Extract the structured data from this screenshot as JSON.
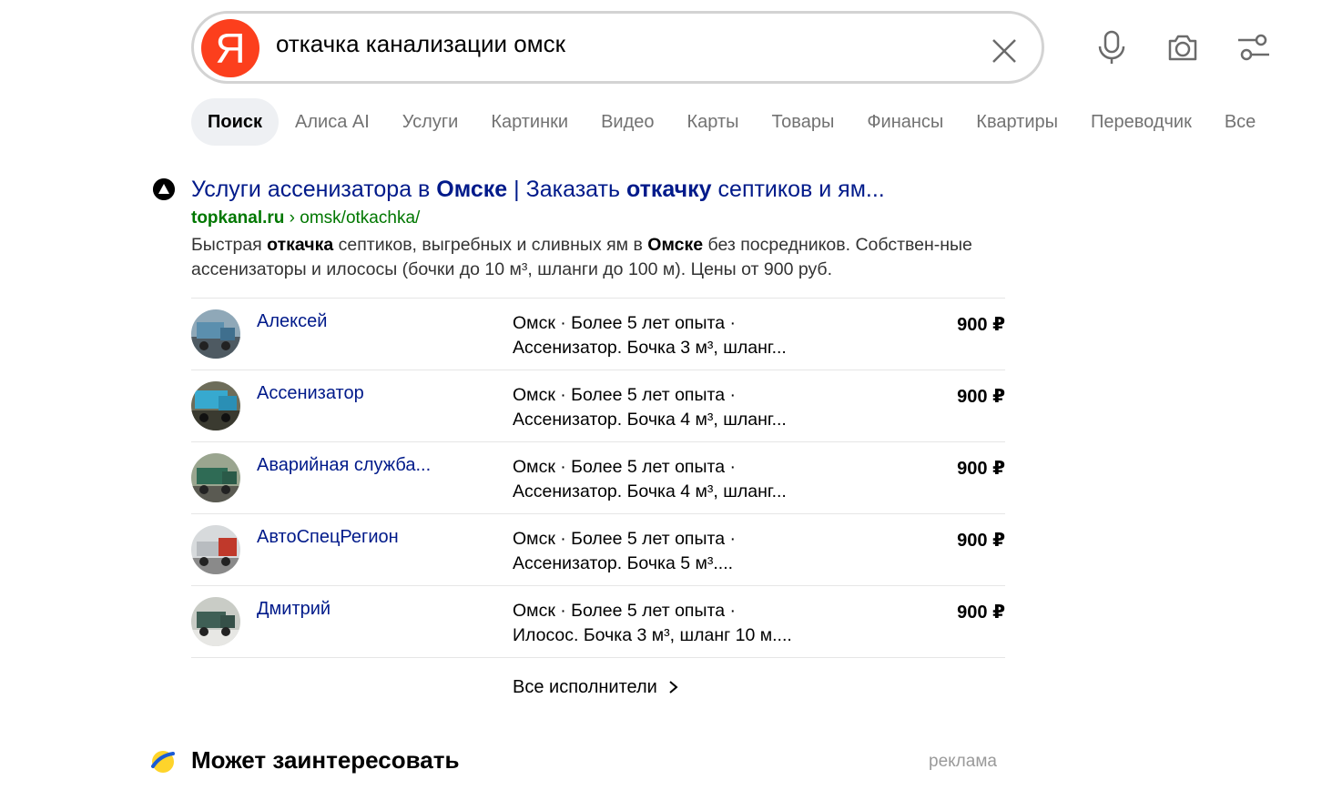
{
  "search": {
    "logo_letter": "Я",
    "query": "откачка канализации омск"
  },
  "tabs": [
    {
      "label": "Поиск",
      "active": true
    },
    {
      "label": "Алиса AI"
    },
    {
      "label": "Услуги"
    },
    {
      "label": "Картинки"
    },
    {
      "label": "Видео"
    },
    {
      "label": "Карты"
    },
    {
      "label": "Товары"
    },
    {
      "label": "Финансы"
    },
    {
      "label": "Квартиры"
    },
    {
      "label": "Переводчик"
    },
    {
      "label": "Все"
    }
  ],
  "result": {
    "title_parts": [
      "Услуги ассенизатора в ",
      "Омске",
      " | Заказать ",
      "откачку",
      " септиков и ям..."
    ],
    "url_domain": "topkanal.ru",
    "url_path": " › omsk/otkachka/",
    "snippet_parts": [
      "Быстрая ",
      "откачка",
      " септиков, выгребных и сливных ям в ",
      "Омске",
      " без посредников. Собствен-ные ассенизаторы и илососы (бочки до 10 м³, шланги до 100 м). Цены от 900 руб."
    ]
  },
  "providers": [
    {
      "name": "Алексей",
      "line1": "Омск · Более 5 лет опыта ·",
      "line2": "Ассенизатор. Бочка 3 м³, шланг...",
      "price": "900 ₽"
    },
    {
      "name": "Ассенизатор",
      "line1": "Омск · Более 5 лет опыта ·",
      "line2": "Ассенизатор. Бочка 4 м³, шланг...",
      "price": "900 ₽"
    },
    {
      "name": "Аварийная служба...",
      "line1": "Омск · Более 5 лет опыта ·",
      "line2": "Ассенизатор. Бочка 4 м³, шланг...",
      "price": "900 ₽"
    },
    {
      "name": "АвтоСпецРегион",
      "line1": "Омск · Более 5 лет опыта ·",
      "line2": "Ассенизатор. Бочка 5 м³....",
      "price": "900 ₽"
    },
    {
      "name": "Дмитрий",
      "line1": "Омск · Более 5 лет опыта ·",
      "line2": "Илосос. Бочка 3 м³, шланг 10 м....",
      "price": "900 ₽"
    }
  ],
  "all_providers_label": "Все исполнители",
  "maybe": {
    "title": "Может заинтересовать",
    "ad_label": "реклама"
  },
  "colors": {
    "link": "#001a8a",
    "url_green": "#007700",
    "logo_red": "#fc3f1d",
    "tab_active_bg": "#eef0f3",
    "tab_text": "#727272"
  }
}
